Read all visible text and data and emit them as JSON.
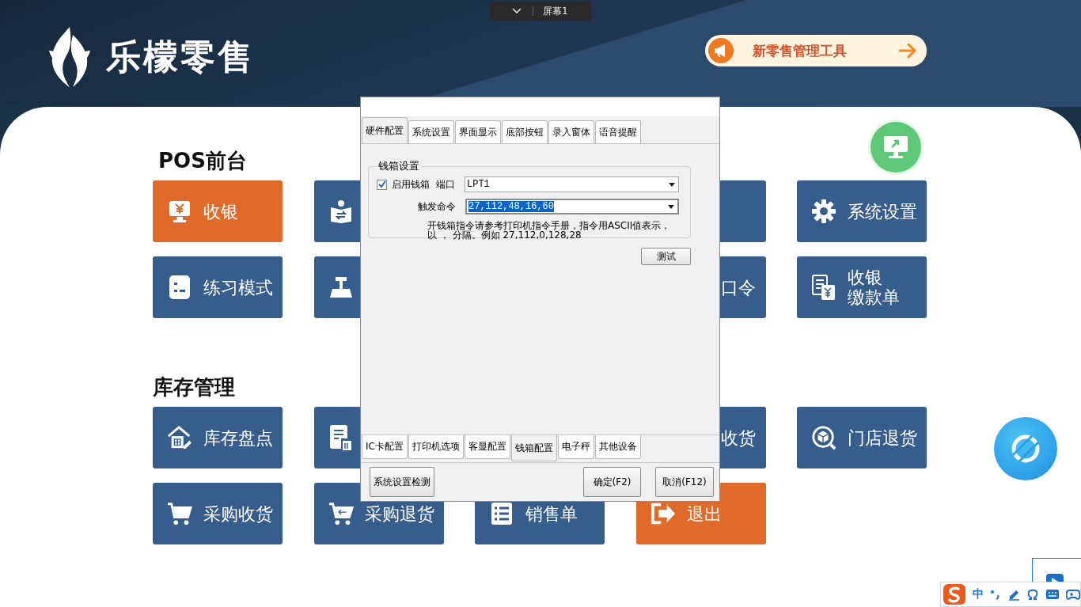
{
  "screen_switcher": {
    "label": "屏幕1"
  },
  "logo": {
    "text": "乐檬零售"
  },
  "promo_button": {
    "label": "新零售管理工具"
  },
  "sections": [
    {
      "title": "POS前台",
      "tiles": [
        {
          "kind": "accent",
          "lines": [
            "收银"
          ]
        },
        {
          "kind": "normal"
        },
        {
          "kind": "normal"
        },
        {
          "kind": "normal",
          "lines": [
            "系统设置"
          ]
        },
        {
          "kind": "normal",
          "lines": [
            "练习模式"
          ]
        },
        {
          "kind": "normal"
        },
        {
          "kind": "normal",
          "lines": [
            "口令"
          ]
        },
        {
          "kind": "normal",
          "lines": [
            "收银",
            "缴款单"
          ]
        }
      ]
    },
    {
      "title": "库存管理",
      "tiles": [
        {
          "kind": "normal",
          "lines": [
            "库存盘点"
          ]
        },
        {
          "kind": "normal"
        },
        {
          "kind": "normal",
          "lines": [
            "收货"
          ]
        },
        {
          "kind": "normal",
          "lines": [
            "门店退货"
          ]
        },
        {
          "kind": "normal",
          "lines": [
            "采购收货"
          ]
        },
        {
          "kind": "normal",
          "lines": [
            "采购退货"
          ]
        },
        {
          "kind": "normal",
          "lines": [
            "销售单"
          ]
        },
        {
          "kind": "accent",
          "lines": [
            "退出"
          ]
        }
      ]
    }
  ],
  "dialog": {
    "top_tabs": [
      {
        "label": "硬件配置",
        "selected": true
      },
      {
        "label": "系统设置",
        "selected": false
      },
      {
        "label": "界面显示",
        "selected": false
      },
      {
        "label": "底部按钮",
        "selected": false
      },
      {
        "label": "录入窗体",
        "selected": false
      },
      {
        "label": "语音提醒",
        "selected": false
      }
    ],
    "group": {
      "title": "钱箱设置",
      "enable": {
        "label": "启用钱箱",
        "checked": true
      },
      "port": {
        "label": "端口",
        "value": "LPT1"
      },
      "trigger": {
        "label": "触发命令",
        "value": "27,112,48,16,60",
        "text_selected": true
      },
      "note_lines": [
        "开钱箱指令请参考打印机指令手册，指令用ASCII值表示，",
        "以 ， 分隔。例如  27,112,0,128,28"
      ]
    },
    "test_button": "测试",
    "bottom_tabs": [
      {
        "label": "IC卡配置",
        "selected": false
      },
      {
        "label": "打印机选项",
        "selected": false
      },
      {
        "label": "客显配置",
        "selected": false
      },
      {
        "label": "钱箱配置",
        "selected": true
      },
      {
        "label": "电子秤",
        "selected": false
      },
      {
        "label": "其他设备",
        "selected": false
      }
    ],
    "check_button": "系统设置检测",
    "ok_button": "确定(F2)",
    "cancel_button": "取消(F12)"
  },
  "ime": {
    "mode": "中"
  }
}
